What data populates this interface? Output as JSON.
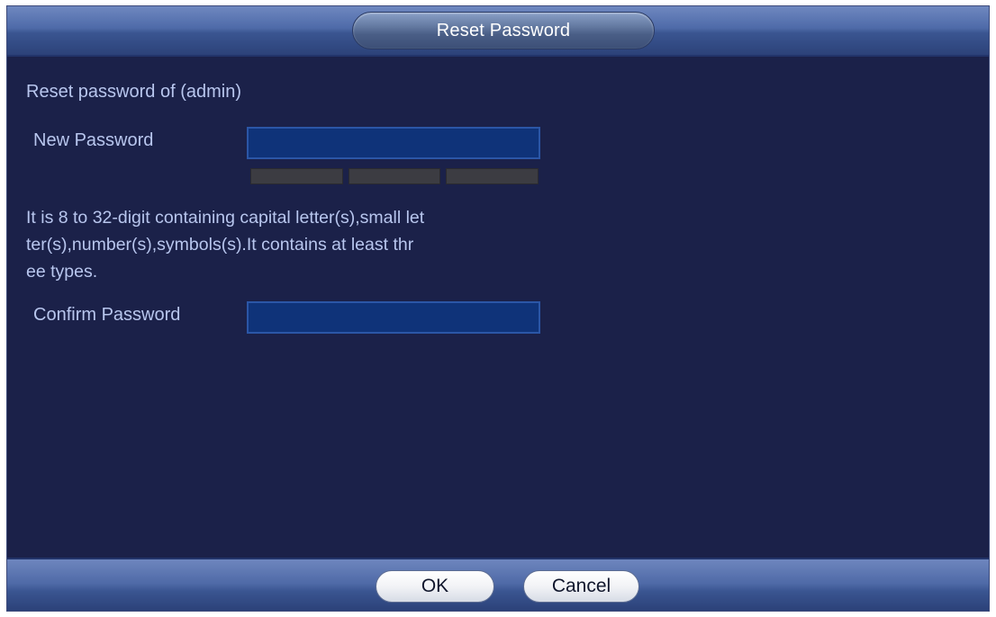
{
  "dialog": {
    "title": "Reset Password"
  },
  "form": {
    "heading": "Reset password of (admin)",
    "new_password_label": "New Password",
    "new_password_value": "",
    "hint": "It is 8 to 32-digit containing capital letter(s),small let\nter(s),number(s),symbols(s).It contains at least thr\nee types.",
    "confirm_password_label": "Confirm Password",
    "confirm_password_value": ""
  },
  "buttons": {
    "ok_label": "OK",
    "cancel_label": "Cancel"
  },
  "colors": {
    "background": "#1b2149",
    "text": "#b8c6ee",
    "input_fill": "#0f3379",
    "strength_empty": "#3c3c42"
  }
}
